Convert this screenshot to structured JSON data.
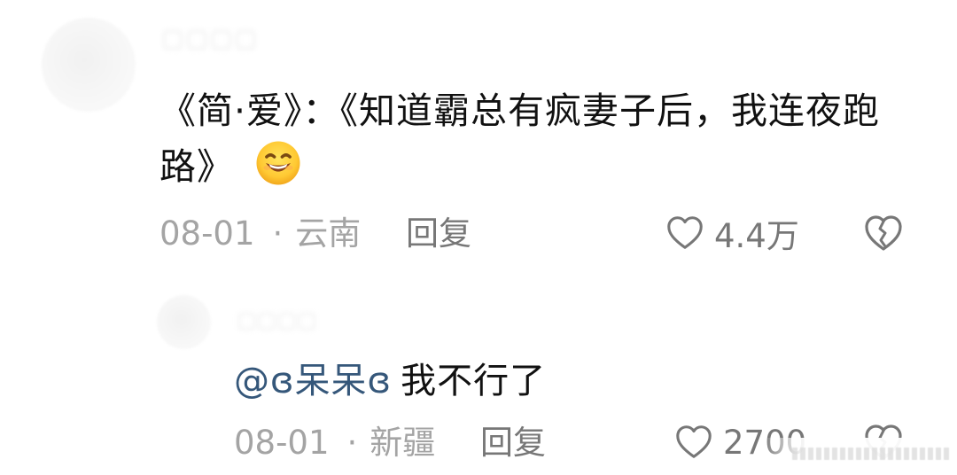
{
  "comment": {
    "text": "《简·爱》：《知道霸总有疯妻子后，我连夜跑路》",
    "emoji": "grinning-face-with-smiling-eyes",
    "date": "08-01",
    "location": "云南",
    "reply_label": "回复",
    "likes": "4.4万"
  },
  "reply": {
    "mention": "@ɞ呆呆ɞ",
    "text": "我不行了",
    "date": "08-01",
    "location": "新疆",
    "reply_label": "回复",
    "likes": "2700"
  },
  "icons": {
    "like": "heart-outline-icon",
    "dislike": "broken-heart-icon"
  },
  "colors": {
    "mention": "#35577a",
    "meta": "#a4a4a4",
    "secondary": "#777777"
  }
}
